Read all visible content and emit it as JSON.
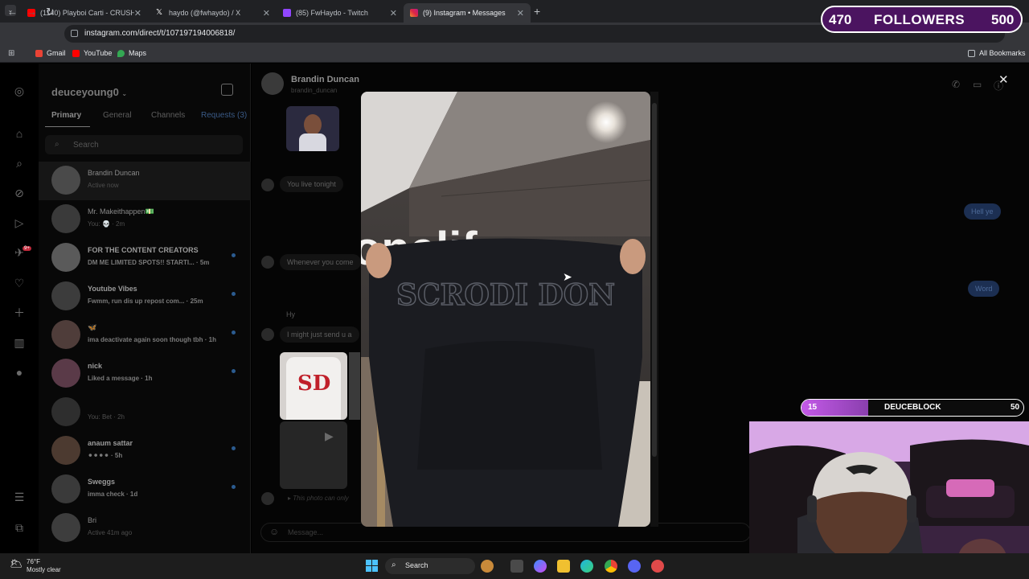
{
  "browser": {
    "tabs": [
      {
        "title": "(1140) Playboi Carti - CRUSH (w",
        "favicon_color": "#ff0000"
      },
      {
        "title": "haydo (@fwhaydo) / X",
        "favicon_color": "#ffffff"
      },
      {
        "title": "(85) FwHaydo - Twitch",
        "favicon_color": "#9146ff"
      },
      {
        "title": "(9) Instagram • Messages",
        "favicon_color": "#e1306c"
      }
    ],
    "url": "instagram.com/direct/t/107197194006818/",
    "bookmarks": [
      "Gmail",
      "YouTube",
      "Maps"
    ],
    "all_bookmarks": "All Bookmarks"
  },
  "instagram": {
    "username": "deuceyoung0",
    "filter_tabs": [
      "Primary",
      "General",
      "Channels",
      "Requests (3)"
    ],
    "search_placeholder": "Search",
    "notification_badge": "9+",
    "conversations": [
      {
        "name": "Brandin Duncan",
        "sub": "Active now",
        "selected": true,
        "unread": false
      },
      {
        "name": "Mr. Makeithappen💵",
        "sub": "You: 💀 · 2m",
        "selected": false,
        "unread": false
      },
      {
        "name": "FOR THE CONTENT CREATORS",
        "sub": "DM ME LIMITED SPOTS!! STARTI... · 5m",
        "selected": false,
        "unread": true
      },
      {
        "name": "Youtube Vibes",
        "sub": "Fwmm, run dis up repost com... · 25m",
        "selected": false,
        "unread": true
      },
      {
        "name": "🦋",
        "sub": "ima deactivate again soon though tbh · 1h",
        "selected": false,
        "unread": true
      },
      {
        "name": "nick",
        "sub": "Liked a message · 1h",
        "selected": false,
        "unread": true
      },
      {
        "name": "",
        "sub": "You: Bet · 2h",
        "selected": false,
        "unread": false
      },
      {
        "name": "anaum sattar",
        "sub": "⚫⚫⚫⚫ · 5h",
        "selected": false,
        "unread": true
      },
      {
        "name": "Sweggs",
        "sub": "imma check · 1d",
        "selected": false,
        "unread": true
      },
      {
        "name": "Bri",
        "sub": "Active 41m ago",
        "selected": false,
        "unread": false
      }
    ],
    "chat": {
      "name": "Brandin Duncan",
      "handle": "brandin_duncan",
      "messages": [
        {
          "text": "You live tonight",
          "mine": false
        },
        {
          "text": "Hell ye",
          "mine": true
        },
        {
          "text": "Whenever you come",
          "mine": false
        },
        {
          "text": "Word",
          "mine": true
        },
        {
          "text": "Hy",
          "mine": false
        },
        {
          "text": "I might just send u a",
          "mine": false
        },
        {
          "text": "This photo can only",
          "mine": false
        }
      ],
      "message_placeholder": "Message..."
    },
    "video": {
      "wall_text": "onelife",
      "hoodie_text": "SCRODI DON"
    }
  },
  "overlays": {
    "followers": {
      "current": "470",
      "label": "FOLLOWERS",
      "goal": "500",
      "progress": 0.0
    },
    "deuceblock": {
      "current": "15",
      "label": "DEUCEBLOCK",
      "goal": "50",
      "progress": 0.3
    }
  },
  "taskbar": {
    "temperature": "76°F",
    "condition": "Mostly clear",
    "search_label": "Search"
  }
}
